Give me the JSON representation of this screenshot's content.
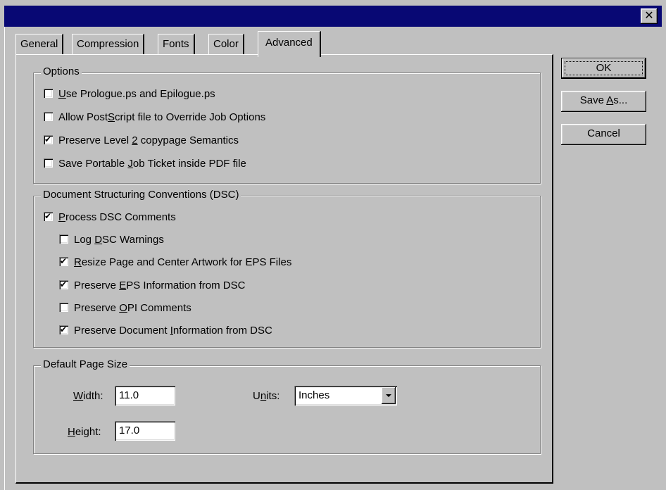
{
  "window": {
    "close_glyph": "✕"
  },
  "tabs": [
    {
      "label": "General",
      "active": false
    },
    {
      "label": "Compression",
      "active": false
    },
    {
      "label": "Fonts",
      "active": false
    },
    {
      "label": "Color",
      "active": false
    },
    {
      "label": "Advanced",
      "active": true
    }
  ],
  "options": {
    "title": "Options",
    "items": [
      {
        "pre": "",
        "u": "U",
        "post": "se Prologue.ps and Epilogue.ps",
        "checked": false
      },
      {
        "pre": "Allow Post",
        "u": "S",
        "post": "cript file to Override Job Options",
        "checked": false
      },
      {
        "pre": "Preserve Level ",
        "u": "2",
        "post": " copypage Semantics",
        "checked": true
      },
      {
        "pre": "Save Portable ",
        "u": "J",
        "post": "ob Ticket inside PDF file",
        "checked": false
      }
    ]
  },
  "dsc": {
    "title": "Document Structuring Conventions (DSC)",
    "items": [
      {
        "pre": "",
        "u": "P",
        "post": "rocess DSC Comments",
        "checked": true
      },
      {
        "pre": "Log ",
        "u": "D",
        "post": "SC Warnings",
        "checked": false
      },
      {
        "pre": "",
        "u": "R",
        "post": "esize Page and Center Artwork for EPS Files",
        "checked": true
      },
      {
        "pre": "Preserve ",
        "u": "E",
        "post": "PS Information from DSC",
        "checked": true
      },
      {
        "pre": "Preserve ",
        "u": "O",
        "post": "PI Comments",
        "checked": false
      },
      {
        "pre": "Preserve Document ",
        "u": "I",
        "post": "nformation from DSC",
        "checked": true
      }
    ]
  },
  "page_size": {
    "title": "Default Page Size",
    "width_label_u": "W",
    "width_label_rest": "idth:",
    "width_value": "11.0",
    "height_label_u": "H",
    "height_label_rest": "eight:",
    "height_value": "17.0",
    "units_label_pre": "U",
    "units_label_u": "n",
    "units_label_post": "its:",
    "units_value": "Inches"
  },
  "buttons": {
    "ok": "OK",
    "save_as_pre": "Save ",
    "save_as_u": "A",
    "save_as_post": "s...",
    "cancel": "Cancel"
  }
}
